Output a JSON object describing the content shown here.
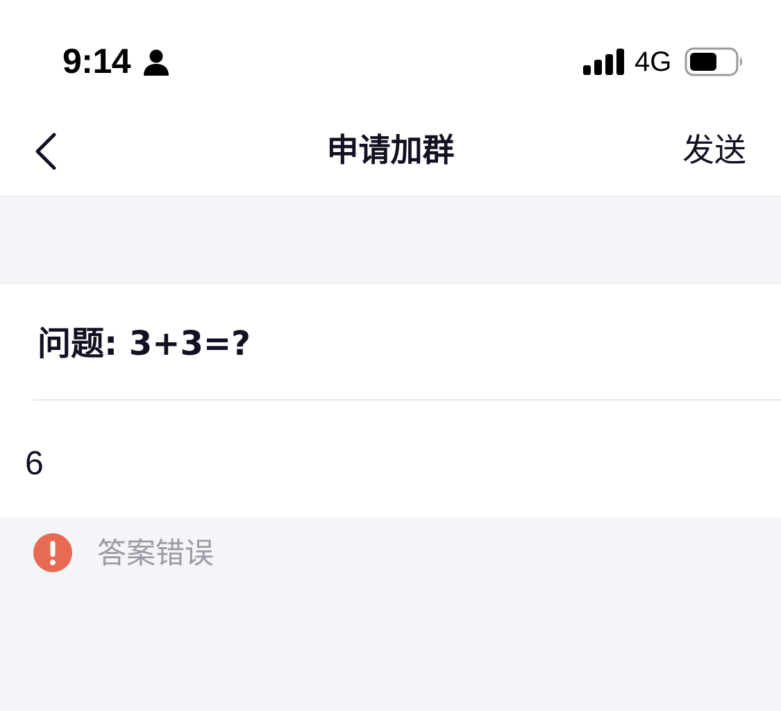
{
  "status_bar": {
    "time": "9:14",
    "network": "4G",
    "icons": [
      "person-icon",
      "signal-bars-icon",
      "battery-icon"
    ]
  },
  "nav": {
    "title": "申请加群",
    "send_label": "发送",
    "back_icon": "chevron-left-icon"
  },
  "question": {
    "text": "问题: 3+3=?"
  },
  "answer": {
    "value": "6"
  },
  "error": {
    "message": "答案错误",
    "icon": "exclamation-icon",
    "color": "#e96a53"
  },
  "colors": {
    "background": "#f4f5f9",
    "card": "#ffffff",
    "text_primary": "#111122",
    "text_secondary": "#9a9ba4"
  }
}
